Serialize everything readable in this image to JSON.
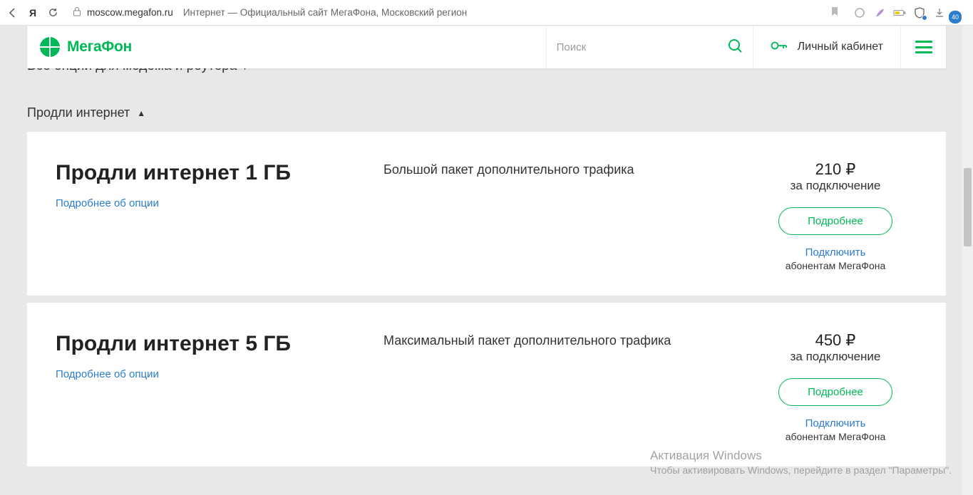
{
  "browser": {
    "domain": "moscow.megafon.ru",
    "title": "Интернет — Официальный сайт МегаФона, Московский регион",
    "badge": "40"
  },
  "header": {
    "logo_text": "МегаФон",
    "search_placeholder": "Поиск",
    "account_label": "Личный кабинет"
  },
  "sections": {
    "cutoff_title": "Все опции для модема и роутера",
    "prodli_title": "Продли интернет"
  },
  "cards": [
    {
      "title": "Продли интернет 1 ГБ",
      "details_link": "Подробнее об опции",
      "description": "Большой пакет дополнительного трафика",
      "price": "210 ₽",
      "price_sub": "за подключение",
      "btn": "Подробнее",
      "connect": "Подключить",
      "note": "абонентам МегаФона"
    },
    {
      "title": "Продли интернет 5 ГБ",
      "details_link": "Подробнее об опции",
      "description": "Максимальный пакет дополнительного трафика",
      "price": "450 ₽",
      "price_sub": "за подключение",
      "btn": "Подробнее",
      "connect": "Подключить",
      "note": "абонентам МегаФона"
    }
  ],
  "watermark": {
    "title": "Активация Windows",
    "line": "Чтобы активировать Windows, перейдите в раздел \"Параметры\"."
  }
}
